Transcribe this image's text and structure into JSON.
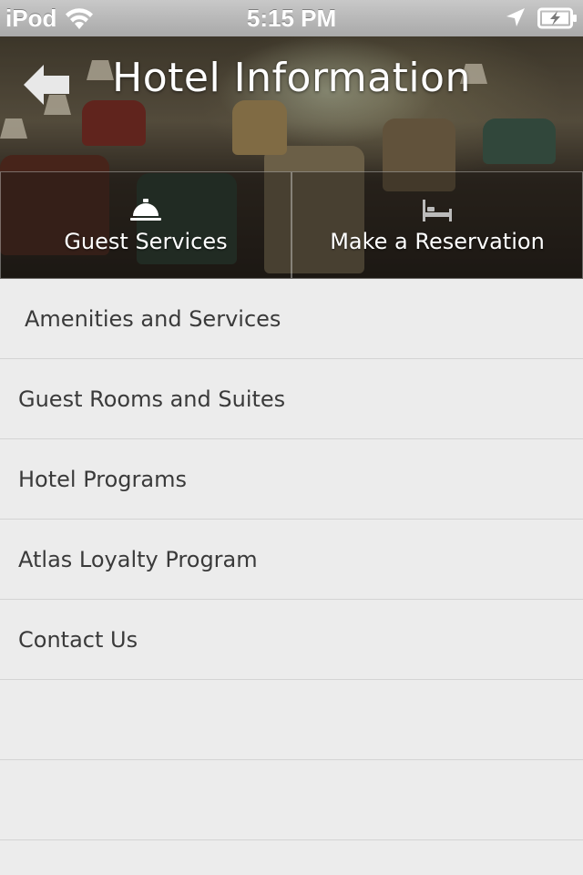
{
  "status_bar": {
    "carrier": "iPod",
    "time": "5:15 PM"
  },
  "header": {
    "title": "Hotel Information",
    "back_icon": "back-arrow-icon"
  },
  "actions": [
    {
      "label": "Guest Services",
      "icon": "service-bell-icon"
    },
    {
      "label": "Make a Reservation",
      "icon": "bed-icon"
    }
  ],
  "menu": {
    "items": [
      {
        "label": "Amenities and Services"
      },
      {
        "label": "Guest Rooms and Suites"
      },
      {
        "label": "Hotel Programs"
      },
      {
        "label": "Atlas Loyalty Program"
      },
      {
        "label": "Contact Us"
      },
      {
        "label": ""
      },
      {
        "label": ""
      }
    ]
  }
}
